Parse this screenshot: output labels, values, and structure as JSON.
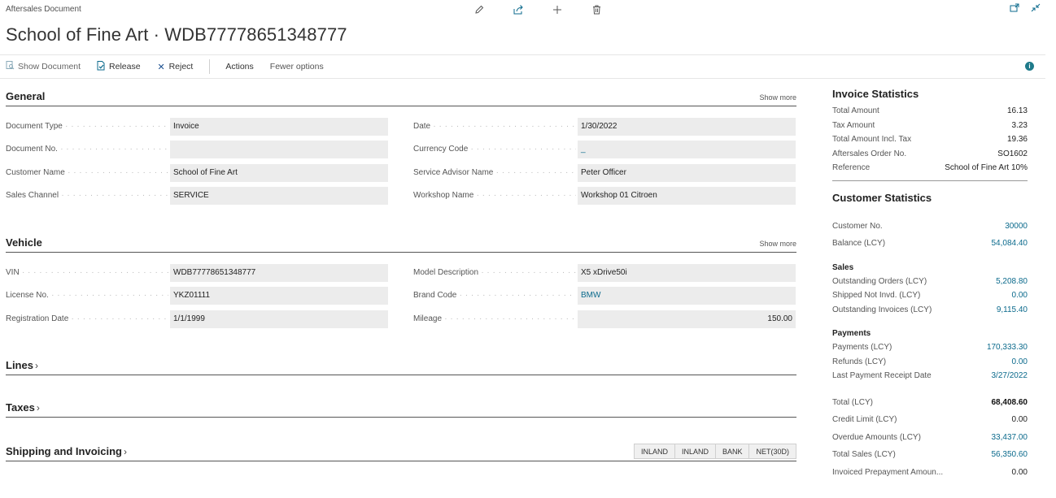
{
  "header": {
    "caption": "Aftersales Document",
    "title": "School of Fine Art · WDB77778651348777"
  },
  "actions": {
    "show_document": "Show Document",
    "release": "Release",
    "reject": "Reject",
    "actions": "Actions",
    "fewer_options": "Fewer options"
  },
  "general": {
    "title": "General",
    "show_more": "Show more",
    "document_type": {
      "label": "Document Type",
      "value": "Invoice"
    },
    "document_no": {
      "label": "Document No.",
      "value": ""
    },
    "customer_name": {
      "label": "Customer Name",
      "value": "School of Fine Art"
    },
    "sales_channel": {
      "label": "Sales Channel",
      "value": "SERVICE"
    },
    "date": {
      "label": "Date",
      "value": "1/30/2022"
    },
    "currency_code": {
      "label": "Currency Code",
      "value": "_"
    },
    "service_advisor": {
      "label": "Service Advisor Name",
      "value": "Peter Officer"
    },
    "workshop_name": {
      "label": "Workshop Name",
      "value": "Workshop 01 Citroen"
    }
  },
  "vehicle": {
    "title": "Vehicle",
    "show_more": "Show more",
    "vin": {
      "label": "VIN",
      "value": "WDB77778651348777"
    },
    "license_no": {
      "label": "License No.",
      "value": "YKZ01111"
    },
    "registration_date": {
      "label": "Registration Date",
      "value": "1/1/1999"
    },
    "model_description": {
      "label": "Model Description",
      "value": "X5 xDrive50i"
    },
    "brand_code": {
      "label": "Brand Code",
      "value": "BMW"
    },
    "mileage": {
      "label": "Mileage",
      "value": "150.00"
    }
  },
  "lines": {
    "title": "Lines"
  },
  "taxes": {
    "title": "Taxes"
  },
  "shipping": {
    "title": "Shipping and Invoicing",
    "tags": [
      "INLAND",
      "INLAND",
      "BANK",
      "NET(30D)"
    ]
  },
  "invoice_stats": {
    "title": "Invoice Statistics",
    "rows": [
      {
        "k": "Total Amount",
        "v": "16.13"
      },
      {
        "k": "Tax Amount",
        "v": "3.23"
      },
      {
        "k": "Total Amount Incl. Tax",
        "v": "19.36"
      },
      {
        "k": "Aftersales Order No.",
        "v": "SO1602"
      },
      {
        "k": "Reference",
        "v": "School of Fine Art 10%"
      }
    ]
  },
  "customer_stats": {
    "title": "Customer Statistics",
    "customer_no": {
      "k": "Customer No.",
      "v": "30000"
    },
    "balance": {
      "k": "Balance (LCY)",
      "v": "54,084.40"
    },
    "sales_title": "Sales",
    "sales": [
      {
        "k": "Outstanding Orders (LCY)",
        "v": "5,208.80"
      },
      {
        "k": "Shipped Not Invd. (LCY)",
        "v": "0.00"
      },
      {
        "k": "Outstanding Invoices (LCY)",
        "v": "9,115.40"
      }
    ],
    "payments_title": "Payments",
    "payments": [
      {
        "k": "Payments (LCY)",
        "v": "170,333.30"
      },
      {
        "k": "Refunds (LCY)",
        "v": "0.00"
      },
      {
        "k": "Last Payment Receipt Date",
        "v": "3/27/2022"
      }
    ],
    "total": {
      "k": "Total (LCY)",
      "v": "68,408.60"
    },
    "credit_limit": {
      "k": "Credit Limit (LCY)",
      "v": "0.00"
    },
    "overdue": {
      "k": "Overdue Amounts (LCY)",
      "v": "33,437.00"
    },
    "total_sales": {
      "k": "Total Sales (LCY)",
      "v": "56,350.60"
    },
    "invoiced_prepayment": {
      "k": "Invoiced Prepayment Amoun...",
      "v": "0.00"
    }
  }
}
